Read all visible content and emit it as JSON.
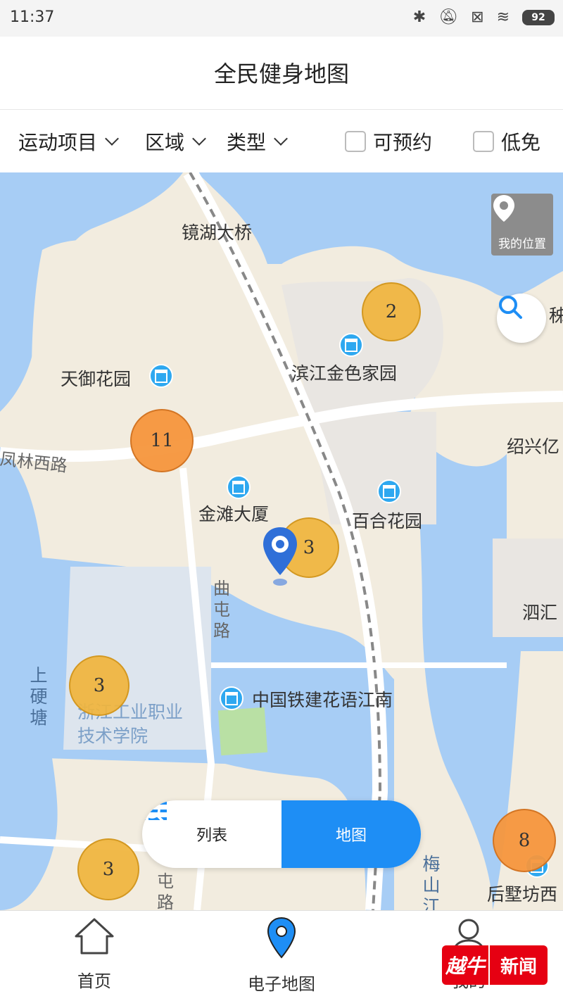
{
  "status": {
    "time": "11:37",
    "battery": "92"
  },
  "header": {
    "title": "全民健身地图"
  },
  "filters": {
    "sport": "运动项目",
    "area": "区域",
    "type": "类型",
    "bookable": "可预约",
    "low_cost": "低免"
  },
  "map": {
    "locate_label": "我的位置",
    "labels": {
      "bridge": "镜湖大桥",
      "tianyu": "天御花园",
      "binjiang": "滨江金色家园",
      "fenglin": "凤林西路",
      "shaoxing": "绍兴亿",
      "jintan": "金滩大厦",
      "baihe": "百合花园",
      "quzhun": "曲屯路",
      "sihui": "泗汇",
      "shangying": "上硬塘",
      "zhongtie": "中国铁建花语江南",
      "college": "浙江工业职业技术学院",
      "meishan": "梅山江",
      "houshu": "后墅坊西",
      "qiao": "秭",
      "road_bottom": "屯路"
    },
    "clusters": {
      "c1": "2",
      "c2": "11",
      "c3": "3",
      "c4": "3",
      "c5": "3",
      "c6": "8"
    }
  },
  "toggle": {
    "list": "列表",
    "map": "地图"
  },
  "nav": {
    "home": "首页",
    "emap": "电子地图",
    "mine": "我的"
  },
  "watermark": {
    "logo": "越牛",
    "text": "新闻"
  },
  "colors": {
    "accent": "#1e8ef5",
    "water": "#a7cdf5",
    "land": "#f2ecdf",
    "cluster_yellow": "#f0b43c",
    "cluster_orange": "#f6963c"
  }
}
